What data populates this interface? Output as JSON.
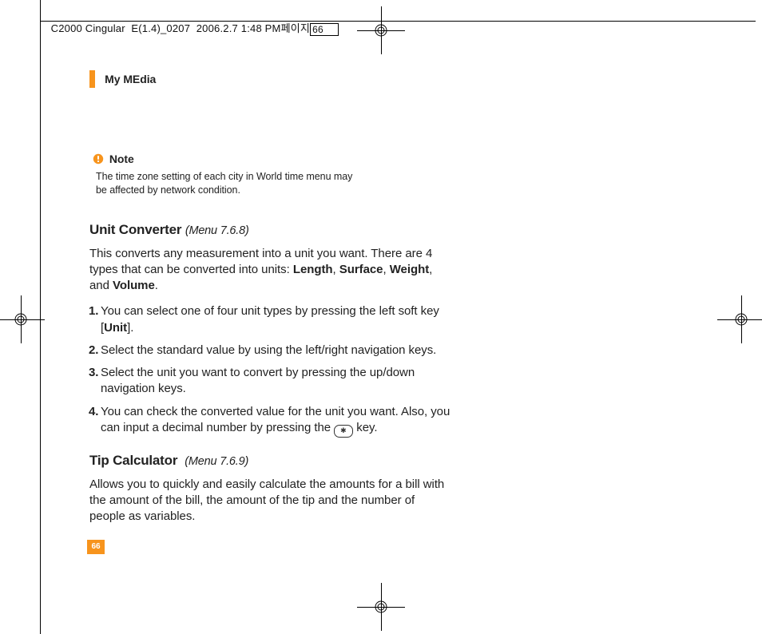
{
  "slug": {
    "doc": "C2000 Cingular  E(1.4)_0207  2006.2.7 1:48 PM",
    "pg_label": "페이지",
    "pg_num": "66"
  },
  "runhead": "My MEdia",
  "note": {
    "label": "Note",
    "body": "The time zone setting of each city in World time menu may be affected by network condition."
  },
  "sections": {
    "unit": {
      "title": "Unit Converter",
      "menu": "(Menu 7.6.8)",
      "intro_a": "This converts any measurement into a unit you want. There are 4 types that can be converted into units: ",
      "types": {
        "a": "Length",
        "b": "Surface",
        "c": "Weight",
        "d": "Volume"
      },
      "steps": {
        "s1_a": "You can select one of four unit types by pressing the left soft key [",
        "s1_unit": "Unit",
        "s1_b": "].",
        "s2": "Select the standard value by using the left/right navigation keys.",
        "s3": "Select the unit you want to convert by pressing the up/down navigation keys.",
        "s4_a": "You can check the converted value for the unit you want. Also, you can input a decimal number by pressing the ",
        "s4_key": "*",
        "s4_b": " key."
      }
    },
    "tip": {
      "title": "Tip Calculator",
      "menu": "(Menu 7.6.9)",
      "body": "Allows you to quickly and easily calculate the amounts for a bill with the amount of the bill, the amount of the tip and the number of people as variables."
    }
  },
  "page_number": "66"
}
